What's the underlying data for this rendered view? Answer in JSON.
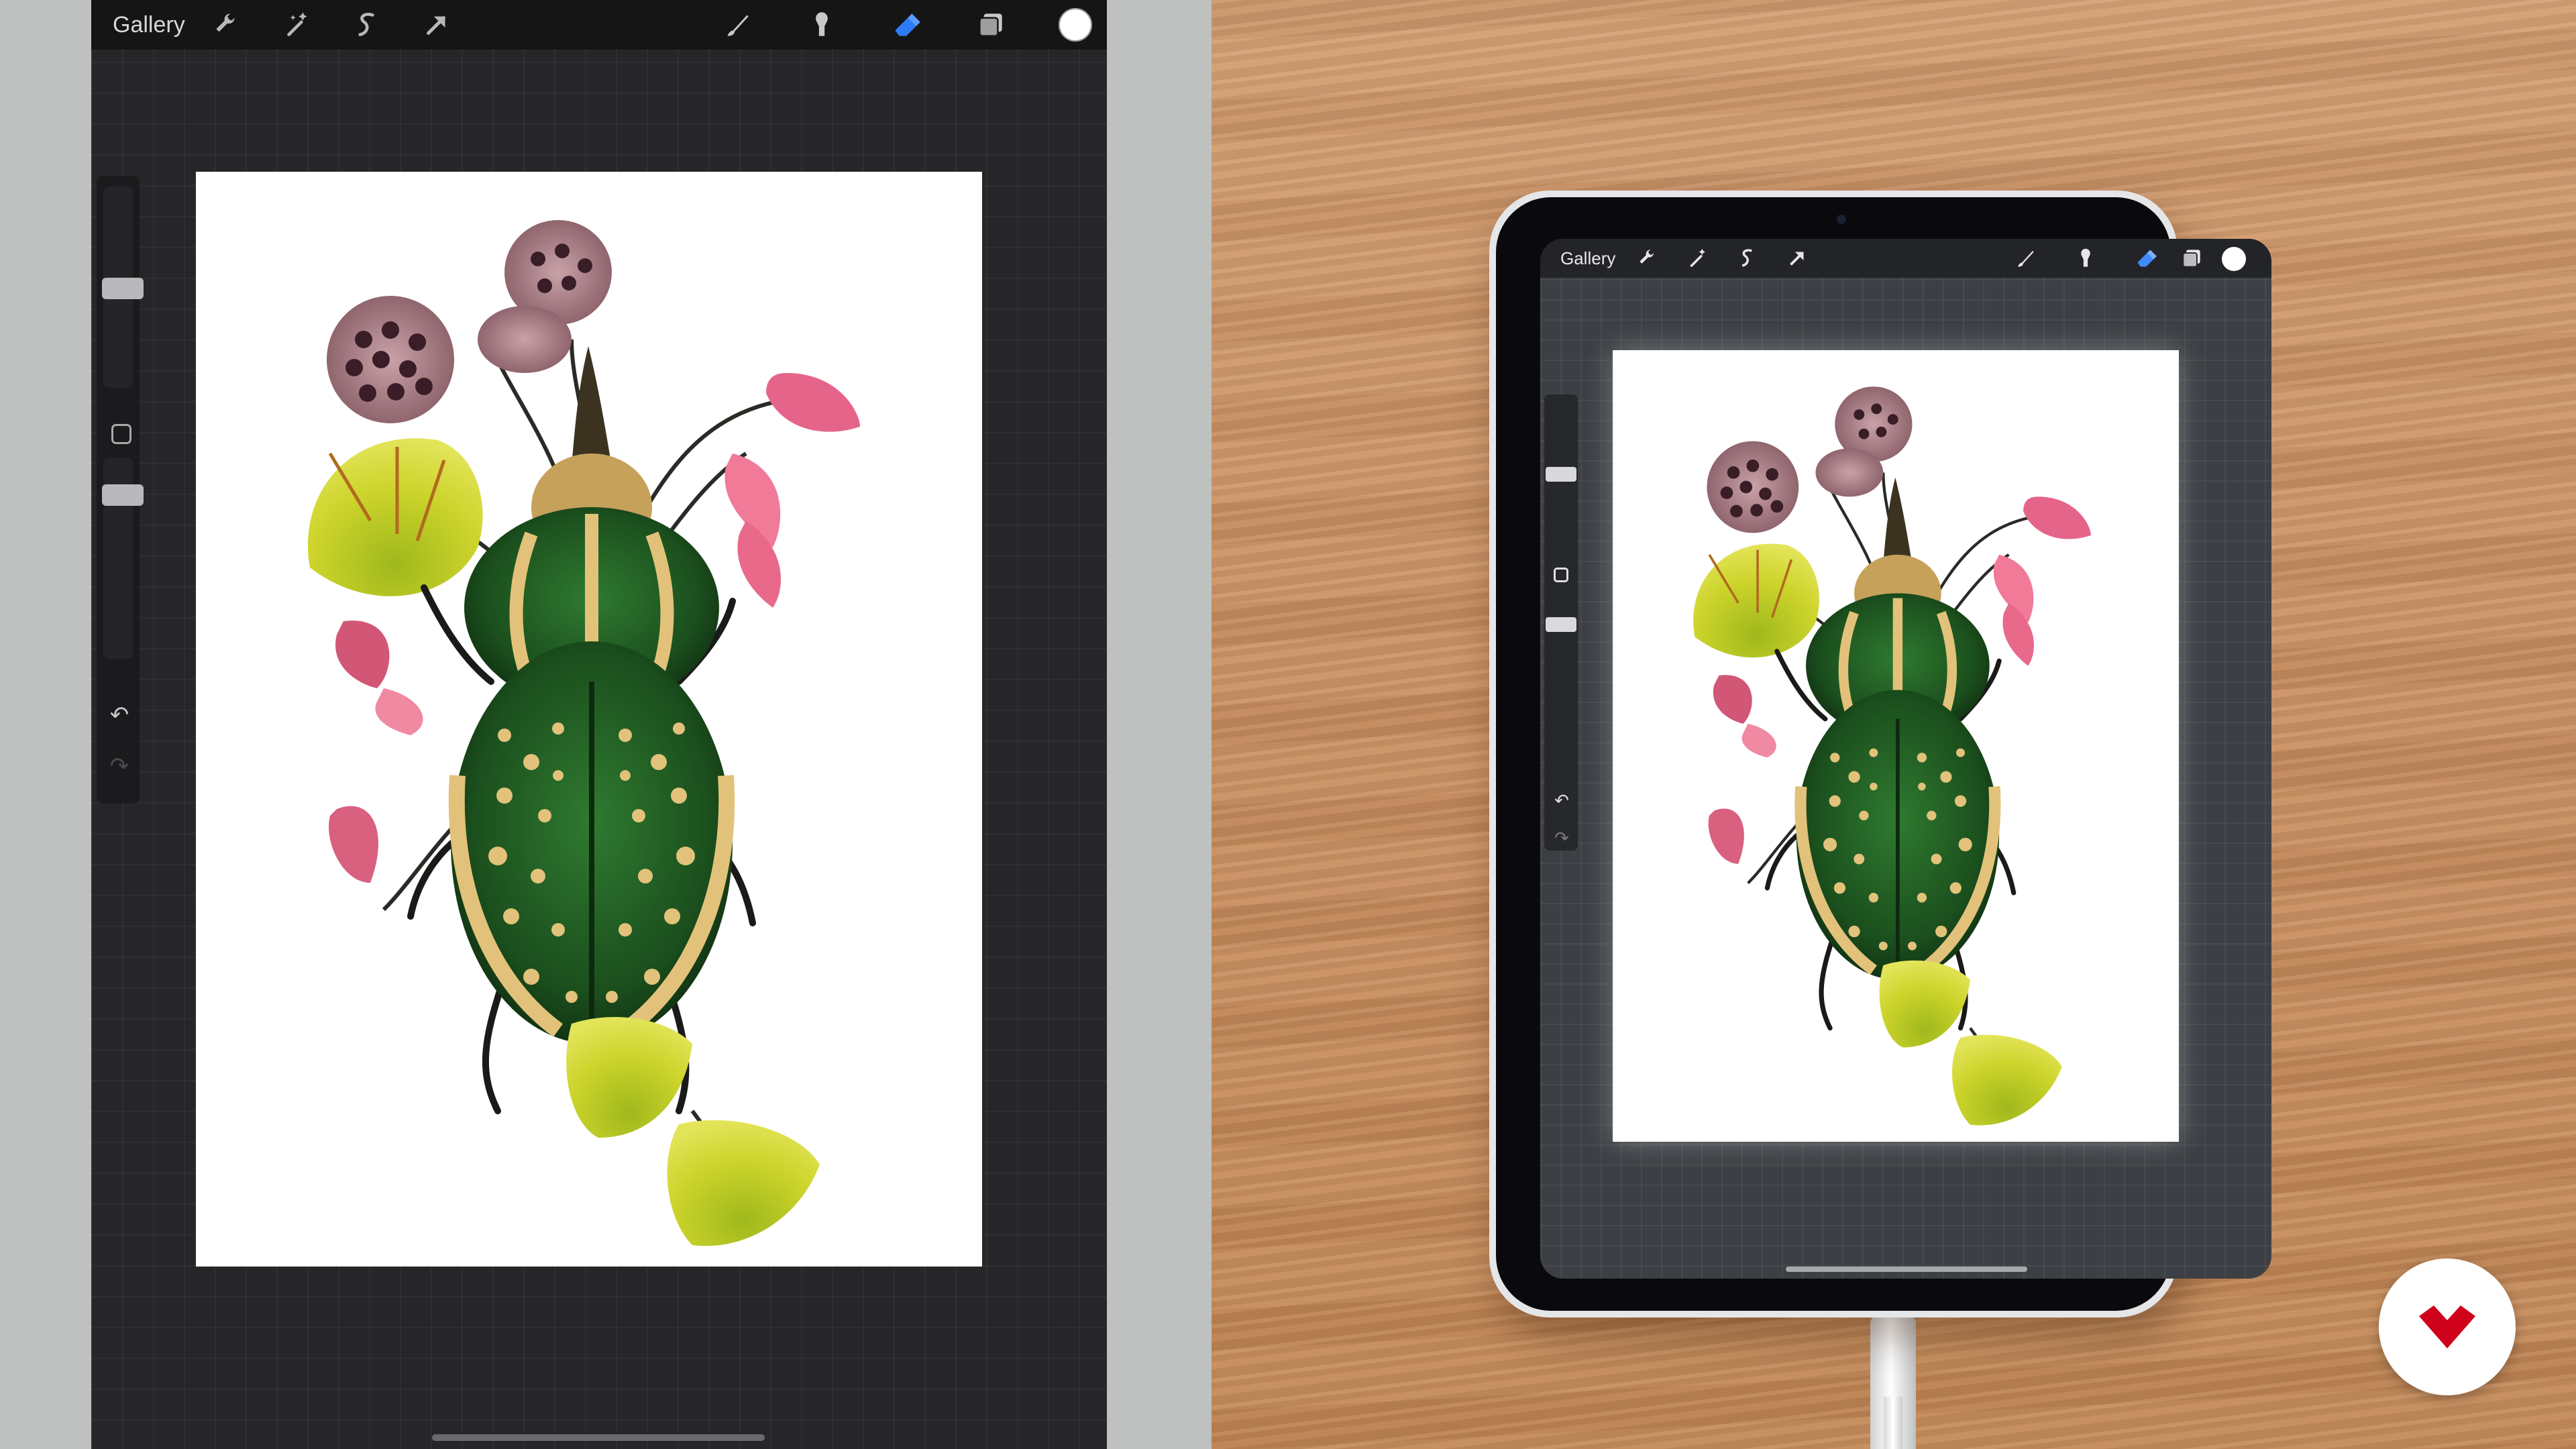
{
  "procreate": {
    "gallery_label": "Gallery",
    "toolbar_icons": [
      "wrench-icon",
      "magic-wand-icon",
      "selection-icon",
      "move-arrow-icon",
      "brush-icon",
      "smudge-icon",
      "eraser-icon",
      "layers-icon",
      "color-swatch"
    ],
    "active_tool": "eraser",
    "accent_color": "#2d7cf6",
    "current_color": "#ffffff"
  },
  "ipad_screen": {
    "gallery_label": "Gallery"
  },
  "colors": {
    "beetle_green": "#1f5a22",
    "beetle_stripe": "#e2c27a",
    "ginkgo_yellow": "#c7cf2a",
    "leaf_pink": "#e8698a",
    "lotus_pod": "#b58b93",
    "desk_wood": "#c98f62",
    "badge_red": "#d0021b"
  }
}
